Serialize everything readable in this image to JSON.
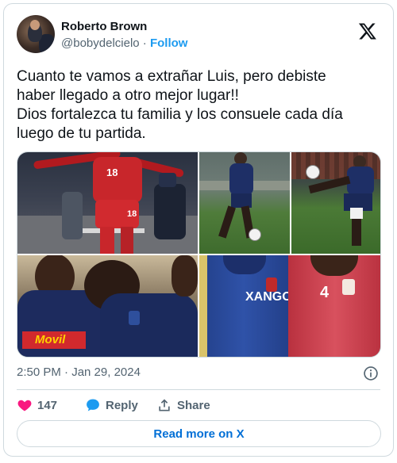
{
  "author": {
    "name": "Roberto Brown",
    "handle": "@bobydelcielo",
    "separator": "·",
    "follow_label": "Follow"
  },
  "tweet": {
    "text": "Cuanto te vamos a extrañar Luis, pero debiste\nhaber llegado a otro mejor lugar!!\nDios fortalezca tu familia y los consuele cada día\nluego de tu partida.",
    "timestamp": "2:50 PM · Jan 29, 2024"
  },
  "media": {
    "jersey_numbers": [
      "18",
      "18",
      "4"
    ],
    "sponsor_text": "Movil",
    "team_text": "XANGO"
  },
  "actions": {
    "like_count": "147",
    "reply_label": "Reply",
    "share_label": "Share"
  },
  "read_more_label": "Read more on X",
  "colors": {
    "accent": "#1d9bf0",
    "like": "#f91880",
    "text": "#0f1419",
    "secondary": "#536471",
    "border": "#cfd9de"
  },
  "icons": [
    "x-logo-icon",
    "info-icon",
    "heart-icon",
    "reply-bubble-icon",
    "share-icon"
  ]
}
